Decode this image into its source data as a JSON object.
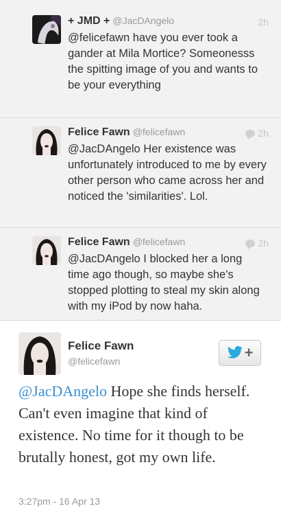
{
  "tweets": [
    {
      "name": "+ JMD +",
      "handle": "@JacDAngelo",
      "time": "2h",
      "text": "@felicefawn have you ever took a gander at Mila Mortice? Someonesss the spitting image of you and wants to be your everything"
    },
    {
      "name": "Felice Fawn",
      "handle": "@felicefawn",
      "time": "2h",
      "text": "@JacDAngelo Her existence was unfortunately introduced to me by every other person who came across her and noticed the 'similarities'. Lol."
    },
    {
      "name": "Felice Fawn",
      "handle": "@felicefawn",
      "time": "2h",
      "text": "@JacDAngelo I blocked her a long time ago though, so maybe she's stopped plotting to steal my skin along with my iPod by now haha."
    }
  ],
  "main": {
    "name": "Felice Fawn",
    "handle": "@felicefawn",
    "mention": "@JacDAngelo",
    "text": " Hope she finds herself. Can't even imagine that kind of existence. No time for it though to be brutally honest, got my own life.",
    "timestamp": "3:27pm - 16 Apr 13",
    "follow_plus": "+"
  },
  "icons": {
    "reply_bubble": "conversation-bubble-icon",
    "follow_bird": "twitter-bird-icon"
  },
  "colors": {
    "mention": "#3a8ed0",
    "twitter_blue": "#2aa9e0"
  }
}
